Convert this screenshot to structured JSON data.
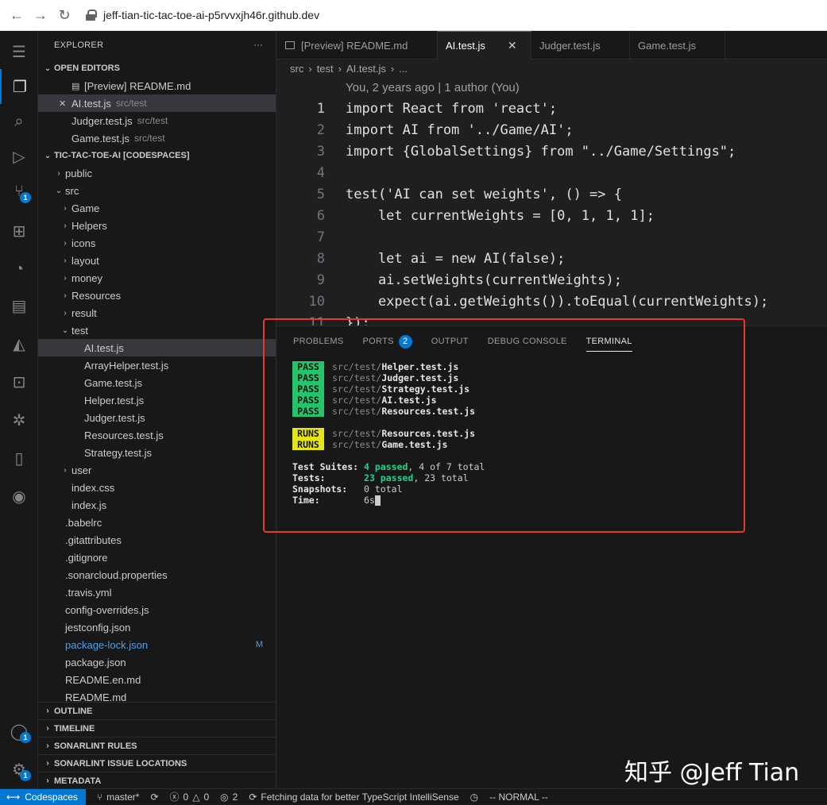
{
  "browser": {
    "url": "jeff-tian-tic-tac-toe-ai-p5rvvxjh46r.github.dev"
  },
  "activity_bar": {
    "scm_badge": "1",
    "accounts_badge": "1",
    "manage_badge": "1"
  },
  "explorer": {
    "title": "EXPLORER",
    "more": "···",
    "open_editors_header": "OPEN EDITORS",
    "open_editors": [
      {
        "label": "[Preview] README.md",
        "desc": ""
      },
      {
        "label": "AI.test.js",
        "desc": "src/test"
      },
      {
        "label": "Judger.test.js",
        "desc": "src/test"
      },
      {
        "label": "Game.test.js",
        "desc": "src/test"
      }
    ],
    "workspace_header": "TIC-TAC-TOE-AI [CODESPACES]",
    "tree": [
      {
        "label": "public",
        "indent": 1,
        "twist": "›"
      },
      {
        "label": "src",
        "indent": 1,
        "twist": "⌄"
      },
      {
        "label": "Game",
        "indent": 2,
        "twist": "›"
      },
      {
        "label": "Helpers",
        "indent": 2,
        "twist": "›"
      },
      {
        "label": "icons",
        "indent": 2,
        "twist": "›"
      },
      {
        "label": "layout",
        "indent": 2,
        "twist": "›"
      },
      {
        "label": "money",
        "indent": 2,
        "twist": "›"
      },
      {
        "label": "Resources",
        "indent": 2,
        "twist": "›"
      },
      {
        "label": "result",
        "indent": 2,
        "twist": "›"
      },
      {
        "label": "test",
        "indent": 2,
        "twist": "⌄"
      },
      {
        "label": "AI.test.js",
        "indent": 3,
        "twist": ""
      },
      {
        "label": "ArrayHelper.test.js",
        "indent": 3,
        "twist": ""
      },
      {
        "label": "Game.test.js",
        "indent": 3,
        "twist": ""
      },
      {
        "label": "Helper.test.js",
        "indent": 3,
        "twist": ""
      },
      {
        "label": "Judger.test.js",
        "indent": 3,
        "twist": ""
      },
      {
        "label": "Resources.test.js",
        "indent": 3,
        "twist": ""
      },
      {
        "label": "Strategy.test.js",
        "indent": 3,
        "twist": ""
      },
      {
        "label": "user",
        "indent": 2,
        "twist": "›"
      },
      {
        "label": "index.css",
        "indent": 2,
        "twist": ""
      },
      {
        "label": "index.js",
        "indent": 2,
        "twist": ""
      },
      {
        "label": ".babelrc",
        "indent": 1,
        "twist": ""
      },
      {
        "label": ".gitattributes",
        "indent": 1,
        "twist": ""
      },
      {
        "label": ".gitignore",
        "indent": 1,
        "twist": ""
      },
      {
        "label": ".sonarcloud.properties",
        "indent": 1,
        "twist": ""
      },
      {
        "label": ".travis.yml",
        "indent": 1,
        "twist": ""
      },
      {
        "label": "config-overrides.js",
        "indent": 1,
        "twist": ""
      },
      {
        "label": "jestconfig.json",
        "indent": 1,
        "twist": ""
      },
      {
        "label": "package-lock.json",
        "indent": 1,
        "twist": "",
        "modified": "M"
      },
      {
        "label": "package.json",
        "indent": 1,
        "twist": ""
      },
      {
        "label": "README.en.md",
        "indent": 1,
        "twist": ""
      },
      {
        "label": "README.md",
        "indent": 1,
        "twist": ""
      }
    ],
    "bottom_sections": [
      "OUTLINE",
      "TIMELINE",
      "SONARLINT RULES",
      "SONARLINT ISSUE LOCATIONS",
      "METADATA"
    ]
  },
  "editor": {
    "tabs": [
      {
        "label": "[Preview] README.md"
      },
      {
        "label": "AI.test.js",
        "close": "✕"
      },
      {
        "label": "Judger.test.js"
      },
      {
        "label": "Game.test.js"
      }
    ],
    "breadcrumb": [
      "src",
      "›",
      "test",
      "›",
      "AI.test.js",
      "›",
      "..."
    ],
    "blame": "You, 2 years ago | 1 author (You)",
    "lines": [
      {
        "n": "1",
        "text": "import React from 'react';"
      },
      {
        "n": "2",
        "text": "import AI from '../Game/AI';"
      },
      {
        "n": "3",
        "text": "import {GlobalSettings} from \"../Game/Settings\";"
      },
      {
        "n": "4",
        "text": ""
      },
      {
        "n": "5",
        "text": "test('AI can set weights', () => {"
      },
      {
        "n": "6",
        "text": "    let currentWeights = [0, 1, 1, 1];"
      },
      {
        "n": "7",
        "text": ""
      },
      {
        "n": "8",
        "text": "    let ai = new AI(false);"
      },
      {
        "n": "9",
        "text": "    ai.setWeights(currentWeights);"
      },
      {
        "n": "10",
        "text": "    expect(ai.getWeights()).toEqual(currentWeights);"
      },
      {
        "n": "11",
        "text": "});"
      }
    ]
  },
  "panel": {
    "tabs": [
      "PROBLEMS",
      "PORTS",
      "OUTPUT",
      "DEBUG CONSOLE",
      "TERMINAL"
    ],
    "ports_badge": "2",
    "terminal": {
      "pass": [
        {
          "tag": "PASS",
          "dir": "src/test/",
          "file": "Helper.test.js"
        },
        {
          "tag": "PASS",
          "dir": "src/test/",
          "file": "Judger.test.js"
        },
        {
          "tag": "PASS",
          "dir": "src/test/",
          "file": "Strategy.test.js"
        },
        {
          "tag": "PASS",
          "dir": "src/test/",
          "file": "AI.test.js"
        },
        {
          "tag": "PASS",
          "dir": "src/test/",
          "file": "Resources.test.js"
        }
      ],
      "runs": [
        {
          "tag": "RUNS",
          "dir": "src/test/",
          "file": "Resources.test.js"
        },
        {
          "tag": "RUNS",
          "dir": "src/test/",
          "file": "Game.test.js"
        }
      ],
      "summary": [
        {
          "label": "Test Suites:",
          "green": "4 passed",
          "rest": ", 4 of 7 total"
        },
        {
          "label": "Tests:      ",
          "green": "23 passed",
          "rest": ", 23 total"
        },
        {
          "label": "Snapshots:  ",
          "green": "",
          "rest": "0 total"
        },
        {
          "label": "Time:       ",
          "green": "",
          "rest": "6s"
        }
      ]
    }
  },
  "statusbar": {
    "remote": "Codespaces",
    "branch": "master*",
    "errors": "0",
    "warnings": "0",
    "ports": "2",
    "message": "Fetching data for better TypeScript IntelliSense",
    "mode": "-- NORMAL --"
  },
  "watermark": "知乎 @Jeff Tian",
  "colors": {
    "accent": "#0078d4",
    "pass": "#23c46b",
    "runs": "#e5e510",
    "annotation": "#e8392c"
  }
}
